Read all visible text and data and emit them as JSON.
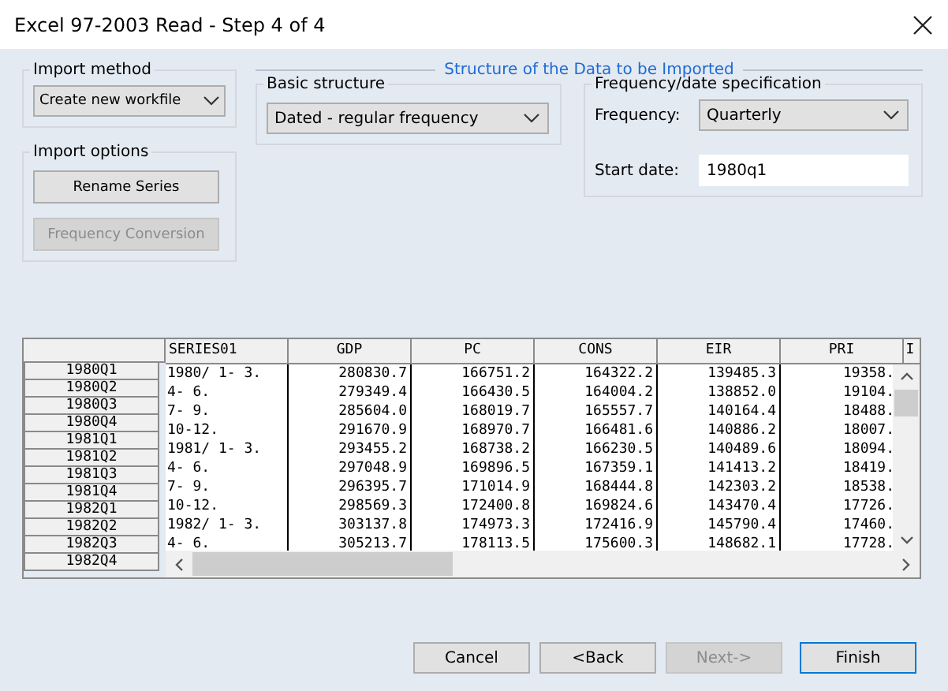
{
  "window": {
    "title": "Excel 97-2003 Read - Step 4 of 4"
  },
  "import_method": {
    "label": "Import method",
    "value": "Create new workfile"
  },
  "import_options": {
    "label": "Import options",
    "buttons": [
      {
        "label": "Rename Series",
        "disabled": false
      },
      {
        "label": "Frequency Conversion",
        "disabled": true
      }
    ]
  },
  "structure": {
    "title": "Structure of the Data to be Imported",
    "basic": {
      "label": "Basic structure",
      "value": "Dated - regular frequency"
    },
    "frequency_spec": {
      "label": "Frequency/date specification",
      "frequency_label": "Frequency:",
      "frequency": "Quarterly",
      "start_label": "Start date:",
      "start_date": "1980q1"
    }
  },
  "table": {
    "columns": [
      "SERIES01",
      "GDP",
      "PC",
      "CONS",
      "EIR",
      "PRI",
      "I"
    ],
    "row_labels": [
      "1980Q1",
      "1980Q2",
      "1980Q3",
      "1980Q4",
      "1981Q1",
      "1981Q2",
      "1981Q3",
      "1981Q4",
      "1982Q1",
      "1982Q2",
      "1982Q3",
      "1982Q4"
    ],
    "rows": [
      [
        "1980/ 1- 3.",
        "280830.7",
        "166751.2",
        "164322.2",
        "139485.3",
        "19358."
      ],
      [
        "4- 6.",
        "279349.4",
        "166430.5",
        "164004.2",
        "138852.0",
        "19104."
      ],
      [
        "7- 9.",
        "285604.0",
        "168019.7",
        "165557.7",
        "140164.4",
        "18488."
      ],
      [
        "10-12.",
        "291670.9",
        "168970.7",
        "166481.6",
        "140886.2",
        "18007."
      ],
      [
        "1981/ 1- 3.",
        "293455.2",
        "168738.2",
        "166230.5",
        "140489.6",
        "18094."
      ],
      [
        "4- 6.",
        "297048.9",
        "169896.5",
        "167359.1",
        "141413.2",
        "18419."
      ],
      [
        "7- 9.",
        "296395.7",
        "171014.9",
        "168444.8",
        "142303.2",
        "18538."
      ],
      [
        "10-12.",
        "298569.3",
        "172400.8",
        "169824.6",
        "143470.4",
        "17726."
      ],
      [
        "1982/ 1- 3.",
        "303137.8",
        "174973.3",
        "172416.9",
        "145790.4",
        "17460."
      ],
      [
        "4- 6.",
        "305213.7",
        "178113.5",
        "175600.3",
        "148682.1",
        "17728."
      ]
    ]
  },
  "buttons": [
    {
      "label": "Cancel",
      "disabled": false,
      "default": false
    },
    {
      "label": "<Back",
      "disabled": false,
      "default": false
    },
    {
      "label": "Next->",
      "disabled": true,
      "default": false
    },
    {
      "label": "Finish",
      "disabled": false,
      "default": true
    }
  ]
}
